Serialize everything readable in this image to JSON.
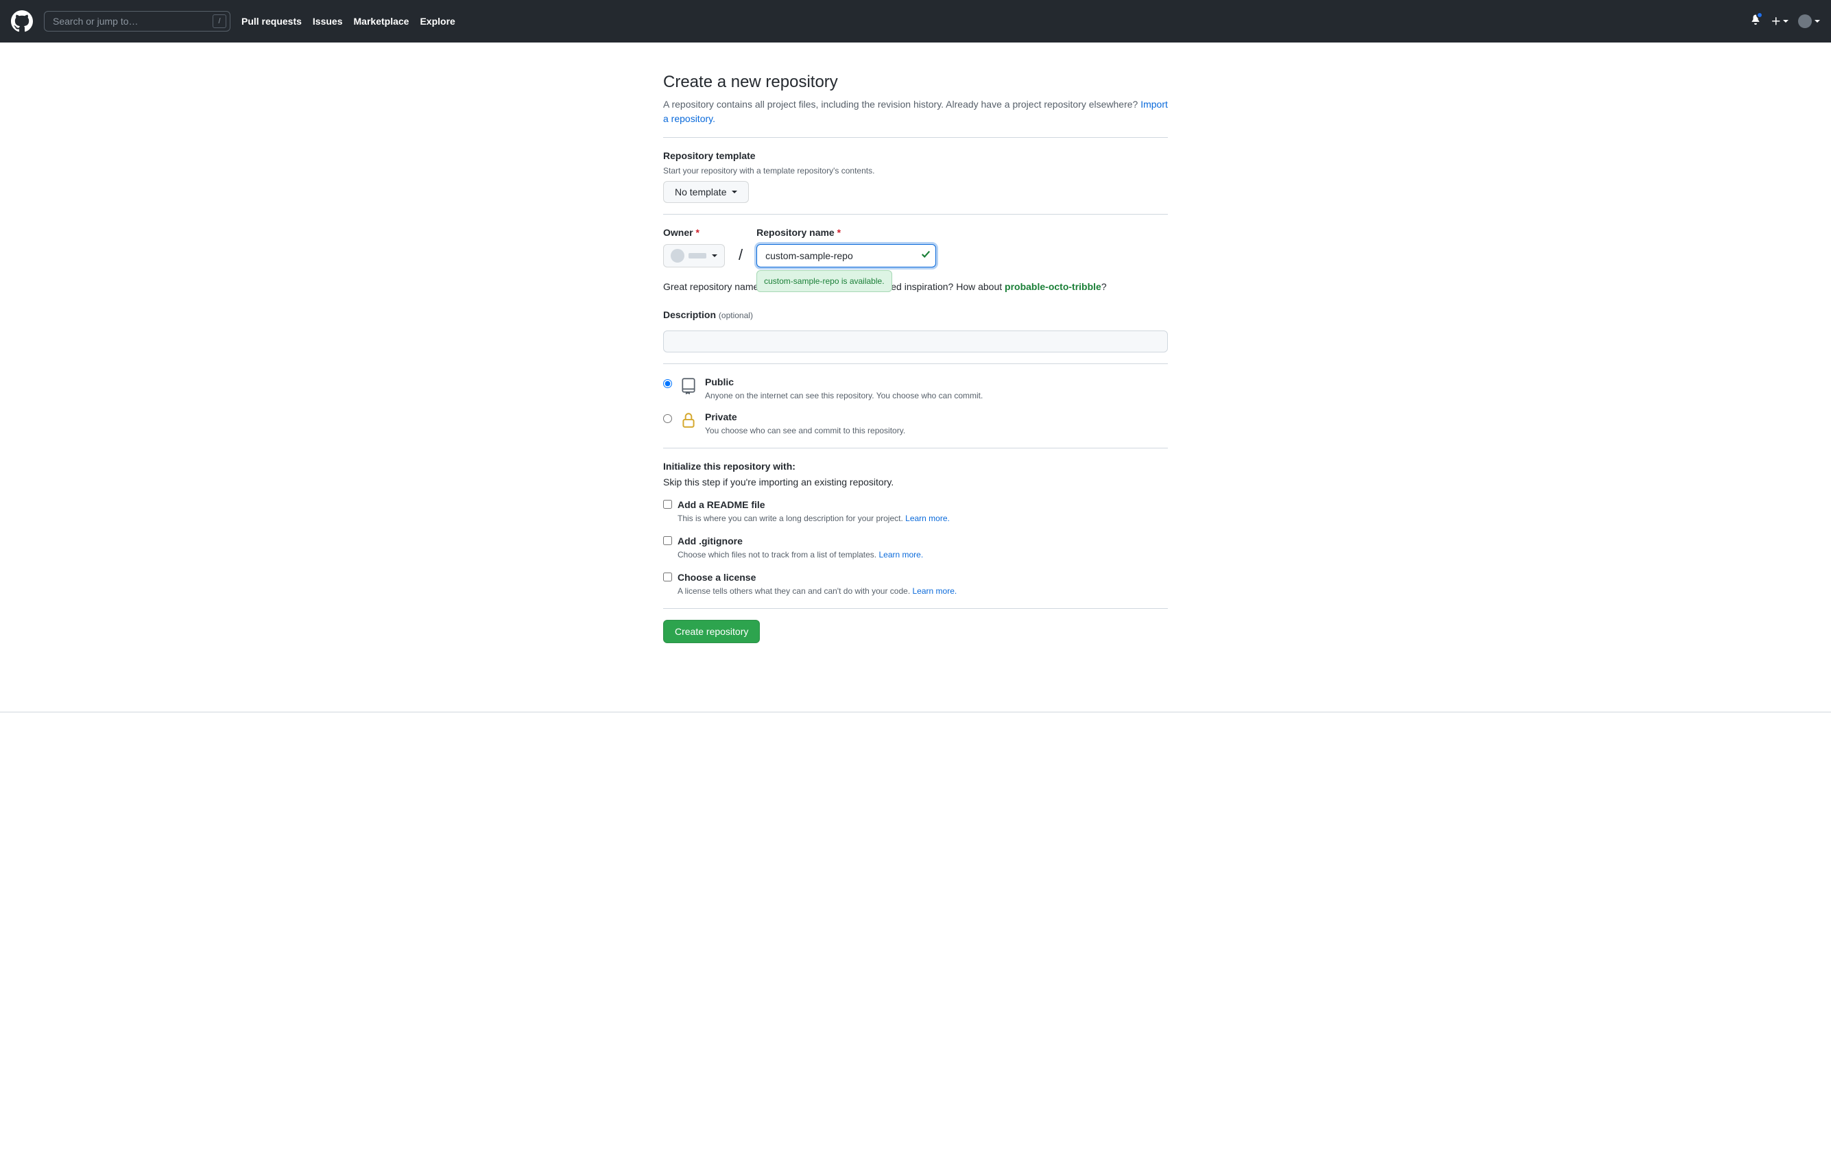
{
  "header": {
    "search_placeholder": "Search or jump to…",
    "search_slash": "/",
    "nav": [
      "Pull requests",
      "Issues",
      "Marketplace",
      "Explore"
    ]
  },
  "page": {
    "title": "Create a new repository",
    "subtitle_pre": "A repository contains all project files, including the revision history. Already have a project repository elsewhere? ",
    "import_link": "Import a repository."
  },
  "template": {
    "heading": "Repository template",
    "subtext": "Start your repository with a template repository's contents.",
    "button": "No template"
  },
  "owner_label": "Owner",
  "repo_name_label": "Repository name",
  "repo_name_value": "custom-sample-repo",
  "avail_tooltip": "custom-sample-repo is available.",
  "inspire": {
    "pre": "Great repository names are short and memorable. Need inspiration? How about ",
    "suggestion": "probable-octo-tribble",
    "post": "?"
  },
  "description": {
    "label": "Description",
    "optional": "(optional)",
    "value": ""
  },
  "visibility": {
    "public": {
      "title": "Public",
      "desc": "Anyone on the internet can see this repository. You choose who can commit."
    },
    "private": {
      "title": "Private",
      "desc": "You choose who can see and commit to this repository."
    }
  },
  "init": {
    "heading": "Initialize this repository with:",
    "subtext": "Skip this step if you're importing an existing repository.",
    "readme": {
      "title": "Add a README file",
      "desc": "This is where you can write a long description for your project. ",
      "learn": "Learn more."
    },
    "gitignore": {
      "title": "Add .gitignore",
      "desc": "Choose which files not to track from a list of templates. ",
      "learn": "Learn more."
    },
    "license": {
      "title": "Choose a license",
      "desc": "A license tells others what they can and can't do with your code. ",
      "learn": "Learn more."
    }
  },
  "submit": "Create repository"
}
